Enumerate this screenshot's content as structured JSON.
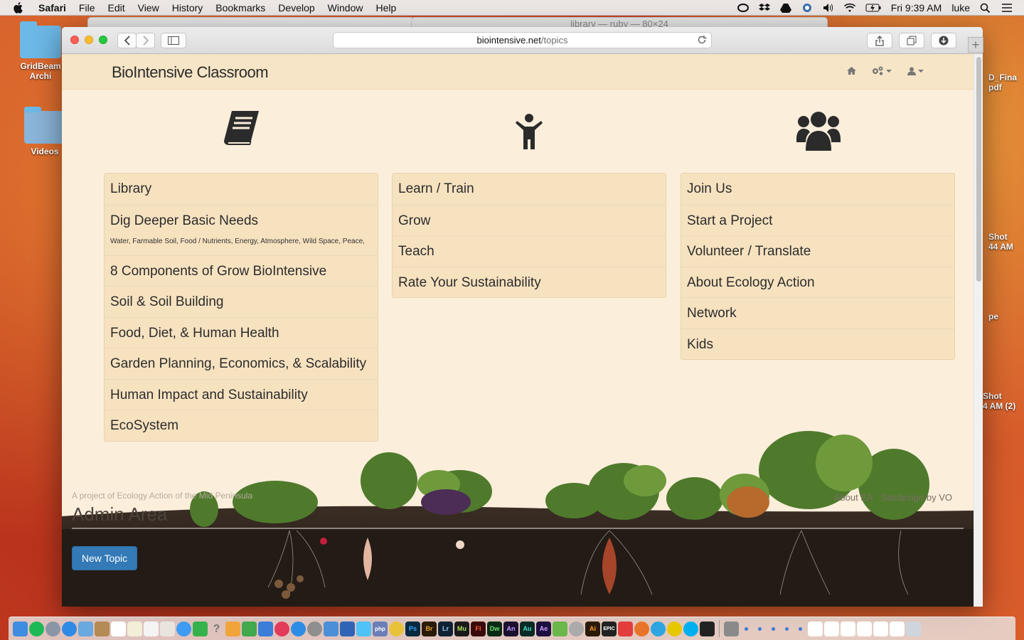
{
  "menubar": {
    "app": "Safari",
    "items": [
      "File",
      "Edit",
      "View",
      "History",
      "Bookmarks",
      "Develop",
      "Window",
      "Help"
    ],
    "clock": "Fri 9:39 AM",
    "user": "luke"
  },
  "desktop": {
    "icons": [
      {
        "label": "GridBeam Archi"
      },
      {
        "label": "Videos"
      }
    ],
    "right_labels": [
      "D_Fina",
      "pdf",
      "Shot",
      "44 AM",
      "pe",
      "Shot",
      "4 AM (2)"
    ]
  },
  "background_window": {
    "title": "library — ruby — 80×24"
  },
  "browser": {
    "url_domain": "biointensive.net",
    "url_path": "/topics",
    "newtab_label": "+"
  },
  "page": {
    "brand": "BioIntensive Classroom",
    "nav_icons": [
      "home-icon",
      "cogs-icon",
      "user-icon"
    ],
    "columns": [
      {
        "icon": "book-icon",
        "items": [
          {
            "label": "Library"
          },
          {
            "label": "Dig Deeper Basic Needs",
            "sub": "Water, Farmable Soil, Food / Nutrients, Energy, Atmosphere, Wild Space, Peace,"
          },
          {
            "label": "8 Components of Grow BioIntensive"
          },
          {
            "label": "Soil & Soil Building"
          },
          {
            "label": "Food, Diet, & Human Health"
          },
          {
            "label": "Garden Planning, Economics, & Scalability"
          },
          {
            "label": "Human Impact and Sustainability"
          },
          {
            "label": "EcoSystem"
          }
        ]
      },
      {
        "icon": "child-icon",
        "items": [
          {
            "label": "Learn / Train"
          },
          {
            "label": "Grow"
          },
          {
            "label": "Teach"
          },
          {
            "label": "Rate Your Sustainability"
          }
        ]
      },
      {
        "icon": "users-icon",
        "items": [
          {
            "label": "Join Us"
          },
          {
            "label": "Start a Project"
          },
          {
            "label": "Volunteer / Translate"
          },
          {
            "label": "About Ecology Action"
          },
          {
            "label": "Network"
          },
          {
            "label": "Kids"
          }
        ]
      }
    ],
    "footer": {
      "project_text": "A project of Ecology Action of the Mid Peninsula",
      "admin_title": "Admin Area",
      "about_link": "About EA",
      "sitedesign_link": "Sitedesign by VO"
    },
    "new_topic_button": "New Topic"
  },
  "dock": {
    "apps": [
      "Finder",
      "Spotify",
      "Launchpad",
      "Safari",
      "Preview",
      "Notes",
      "Calendar",
      "TextEdit",
      "Reminders",
      "Photos",
      "Messages",
      "FaceTime",
      "Help",
      "Pages",
      "Numbers",
      "Keynote",
      "iTunes",
      "App Store",
      "System Preferences",
      "Finder2",
      "Xcode",
      "Word",
      "PHP",
      "Chrome",
      "Ps",
      "Br",
      "Lr",
      "Mu",
      "Fl",
      "Dw",
      "An",
      "Au",
      "Ae",
      "Maps",
      "Terminal",
      "Ai",
      "EPIC",
      "Sketch",
      "Firefox",
      "Telegram",
      "Ultra",
      "Skype",
      "Console",
      "Archive"
    ]
  }
}
